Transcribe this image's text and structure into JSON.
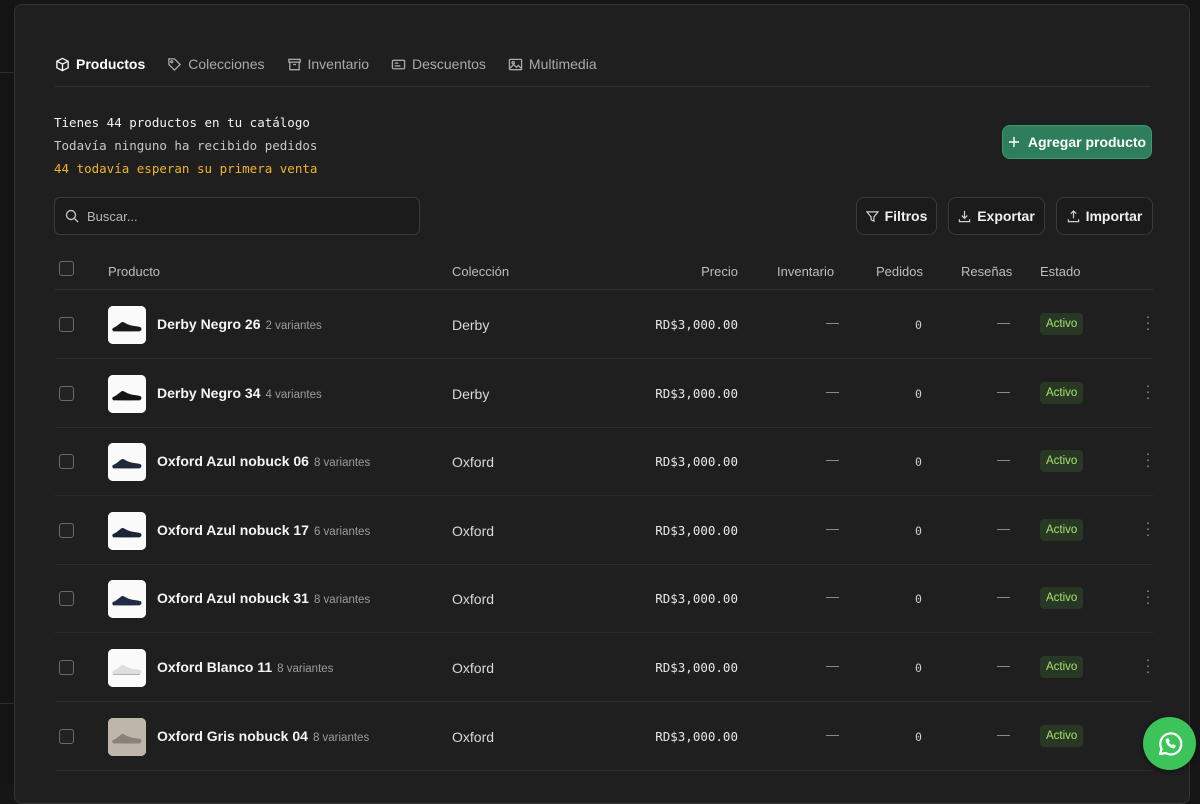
{
  "tabs": [
    {
      "label": "Productos",
      "icon": "box-icon"
    },
    {
      "label": "Colecciones",
      "icon": "tag-icon"
    },
    {
      "label": "Inventario",
      "icon": "archive-icon"
    },
    {
      "label": "Descuentos",
      "icon": "ticket-icon"
    },
    {
      "label": "Multimedia",
      "icon": "image-icon"
    }
  ],
  "summary": {
    "line1": "Tienes 44 productos en tu catálogo",
    "line2": "Todavía ninguno ha recibido pedidos",
    "line3": "44 todavía esperan su primera venta"
  },
  "actions": {
    "add_product": "Agregar producto",
    "filters": "Filtros",
    "export": "Exportar",
    "import": "Importar"
  },
  "search": {
    "placeholder": "Buscar..."
  },
  "table": {
    "headers": {
      "product": "Producto",
      "collection": "Colección",
      "price": "Precio",
      "inventory": "Inventario",
      "orders": "Pedidos",
      "reviews": "Reseñas",
      "status": "Estado"
    },
    "rows": [
      {
        "name": "Derby Negro 26",
        "variants": "2 variantes",
        "collection": "Derby",
        "price": "RD$3,000.00",
        "inventory": "—",
        "orders": "0",
        "reviews": "—",
        "status": "Activo",
        "shoe_color": "#1a1a1a",
        "thumb_bg": "#fafafa"
      },
      {
        "name": "Derby Negro 34",
        "variants": "4 variantes",
        "collection": "Derby",
        "price": "RD$3,000.00",
        "inventory": "—",
        "orders": "0",
        "reviews": "—",
        "status": "Activo",
        "shoe_color": "#151515",
        "thumb_bg": "#fafafa"
      },
      {
        "name": "Oxford Azul nobuck 06",
        "variants": "8 variantes",
        "collection": "Oxford",
        "price": "RD$3,000.00",
        "inventory": "—",
        "orders": "0",
        "reviews": "—",
        "status": "Activo",
        "shoe_color": "#1f2a3d",
        "thumb_bg": "#fafafa"
      },
      {
        "name": "Oxford Azul nobuck 17",
        "variants": "6 variantes",
        "collection": "Oxford",
        "price": "RD$3,000.00",
        "inventory": "—",
        "orders": "0",
        "reviews": "—",
        "status": "Activo",
        "shoe_color": "#1c2538",
        "thumb_bg": "#fafafa"
      },
      {
        "name": "Oxford Azul nobuck 31",
        "variants": "8 variantes",
        "collection": "Oxford",
        "price": "RD$3,000.00",
        "inventory": "—",
        "orders": "0",
        "reviews": "—",
        "status": "Activo",
        "shoe_color": "#1e2b40",
        "thumb_bg": "#fafafa"
      },
      {
        "name": "Oxford Blanco 11",
        "variants": "8 variantes",
        "collection": "Oxford",
        "price": "RD$3,000.00",
        "inventory": "—",
        "orders": "0",
        "reviews": "—",
        "status": "Activo",
        "shoe_color": "#dedede",
        "thumb_bg": "#fafafa"
      },
      {
        "name": "Oxford Gris nobuck 04",
        "variants": "8 variantes",
        "collection": "Oxford",
        "price": "RD$3,000.00",
        "inventory": "—",
        "orders": "0",
        "reviews": "—",
        "status": "Activo",
        "shoe_color": "#8a8278",
        "thumb_bg": "#bdb6ab"
      }
    ]
  },
  "colors": {
    "accent": "#2e7d5b",
    "warning_text": "#f0b429",
    "active_badge_text": "#a7e06d",
    "whatsapp": "#3cc35a"
  }
}
